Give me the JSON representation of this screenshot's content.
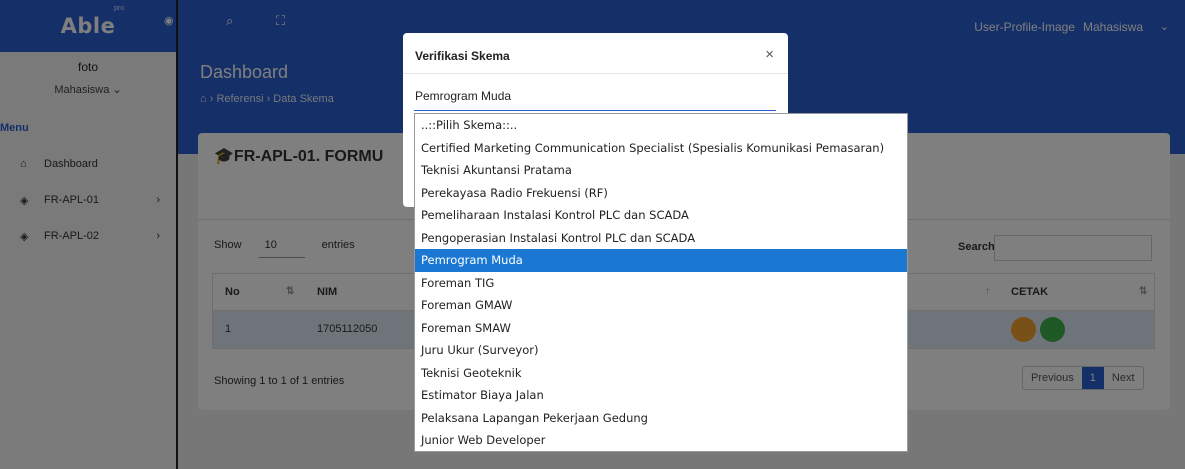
{
  "sidebar": {
    "brand": "Able",
    "brand_badge": "pro",
    "profile_photo": "foto",
    "role": "Mahasiswa",
    "menu_title": "Menu",
    "items": [
      {
        "label": "Dashboard",
        "icon": "home-icon"
      },
      {
        "label": "FR-APL-01",
        "icon": "layers-icon"
      },
      {
        "label": "FR-APL-02",
        "icon": "layers-icon"
      }
    ]
  },
  "topbar": {
    "user_image_alt": "User-Profile-Image",
    "user_name": "Mahasiswa"
  },
  "header": {
    "title": "Dashboard",
    "breadcrumb": [
      "Referensi",
      "Data Skema"
    ]
  },
  "card": {
    "title": "FR-APL-01. FORMU",
    "show_label": "Show",
    "entries_value": "10",
    "entries_label": "entries",
    "search_label": "Search:",
    "columns": [
      "No",
      "NIM",
      "CETAK"
    ],
    "rows": [
      {
        "no": "1",
        "nim": "1705112050"
      }
    ],
    "info": "Showing 1 to 1 of 1 entries",
    "pager": {
      "previous": "Previous",
      "page": "1",
      "next": "Next"
    }
  },
  "modal": {
    "title": "Verifikasi Skema",
    "close": "×",
    "selected_value": "Pemrogram Muda"
  },
  "dropdown": {
    "options": [
      "..::Pilih Skema::..",
      "Certified Marketing Communication Specialist (Spesialis Komunikasi Pemasaran)",
      "Teknisi Akuntansi Pratama",
      "Perekayasa Radio Frekuensi (RF)",
      "Pemeliharaan Instalasi Kontrol PLC dan SCADA",
      "Pengoperasian Instalasi Kontrol PLC dan SCADA",
      "Pemrogram Muda",
      "Foreman TIG",
      "Foreman GMAW",
      "Foreman SMAW",
      "Juru Ukur (Surveyor)",
      "Teknisi Geoteknik",
      "Estimator Biaya Jalan",
      "Pelaksana Lapangan Pekerjaan Gedung",
      "Junior Web Developer"
    ],
    "selected_index": 6
  },
  "colors": {
    "primary": "#2b5ed0",
    "selected": "#1a78d2",
    "print_orange": "#f0a030",
    "print_green": "#3cb04a"
  }
}
